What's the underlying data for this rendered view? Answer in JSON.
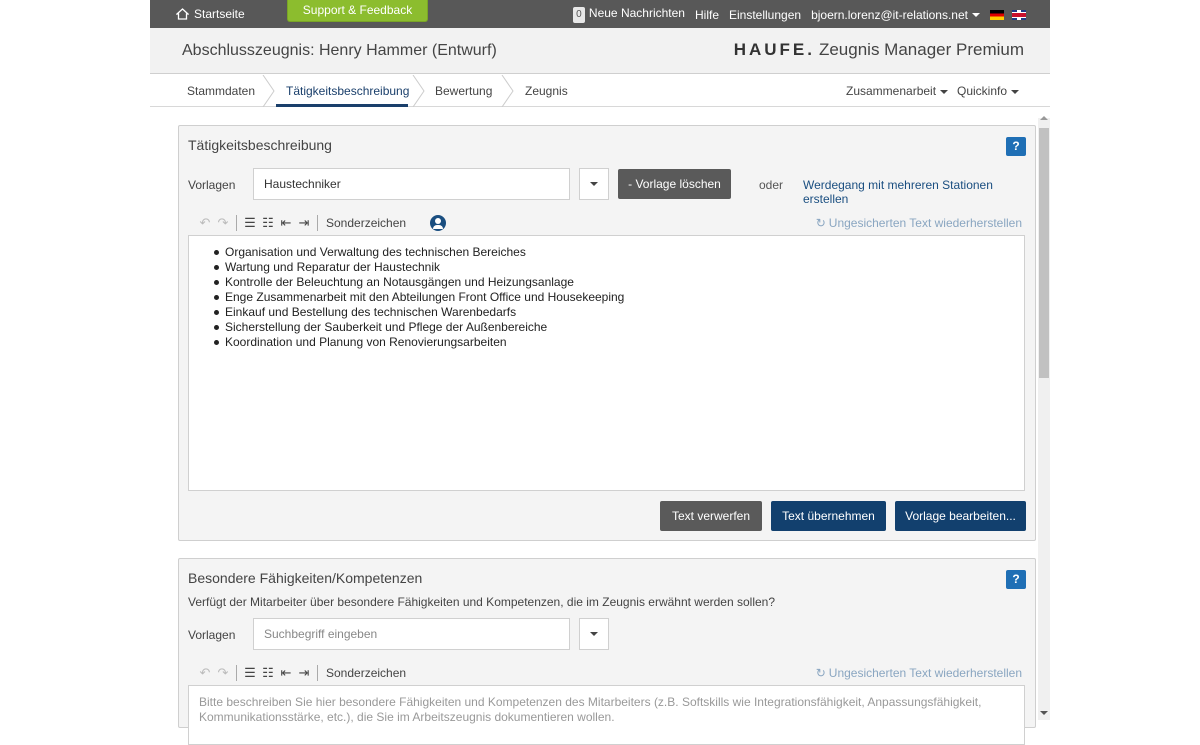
{
  "topbar": {
    "home_label": "Startseite",
    "support_label": "Support & Feedback",
    "messages_count": "0",
    "messages_label": "Neue Nachrichten",
    "help_label": "Hilfe",
    "settings_label": "Einstellungen",
    "user_email": "bjoern.lorenz@it-relations.net"
  },
  "header": {
    "doc_title": "Abschlusszeugnis: Henry Hammer (Entwurf)",
    "brand_logo": "HAUFE.",
    "brand_product": "Zeugnis Manager Premium"
  },
  "tabs": {
    "items": [
      "Stammdaten",
      "Tätigkeitsbeschreibung",
      "Bewertung",
      "Zeugnis"
    ],
    "active": "Tätigkeitsbeschreibung",
    "menu_collab": "Zusammenarbeit",
    "menu_quickinfo": "Quickinfo"
  },
  "panel1": {
    "title": "Tätigkeitsbeschreibung",
    "help": "?",
    "vorlagen_label": "Vorlagen",
    "vorlagen_value": "Haustechniker",
    "delete_template": "- Vorlage löschen",
    "or_label": "oder",
    "career_link": "Werdegang mit mehreren Stationen erstellen",
    "toolbar_special": "Sonderzeichen",
    "restore_label": "Ungesicherten Text wiederherstellen",
    "bullets": [
      "Organisation und Verwaltung des technischen Bereiches",
      "Wartung und Reparatur der Haustechnik",
      "Kontrolle der Beleuchtung an Notausgängen und Heizungsanlage",
      "Enge Zusammenarbeit mit den Abteilungen Front Office und Housekeeping",
      "Einkauf und Bestellung des technischen Warenbedarfs",
      "Sicherstellung der Sauberkeit und Pflege der Außenbereiche",
      "Koordination und Planung von Renovierungsarbeiten"
    ],
    "btn_discard": "Text verwerfen",
    "btn_accept": "Text übernehmen",
    "btn_edit_template": "Vorlage bearbeiten..."
  },
  "panel2": {
    "title": "Besondere Fähigkeiten/Kompetenzen",
    "help": "?",
    "question": "Verfügt der Mitarbeiter über besondere Fähigkeiten und Kompetenzen, die im Zeugnis erwähnt werden sollen?",
    "vorlagen_label": "Vorlagen",
    "search_placeholder": "Suchbegriff eingeben",
    "toolbar_special": "Sonderzeichen",
    "restore_label": "Ungesicherten Text wiederherstellen",
    "editor_placeholder": "Bitte beschreiben Sie hier besondere Fähigkeiten und Kompetenzen des Mitarbeiters (z.B. Softskills wie Integrationsfähigkeit, Anpassungsfähigkeit, Kommunikationsstärke, etc.), die Sie im Arbeitszeugnis dokumentieren wollen."
  },
  "colors": {
    "topbar": "#585858",
    "support": "#8cbd2e",
    "primary_blue": "#12406e",
    "button_gray": "#5a5a5a",
    "help_blue": "#1f6fb5"
  }
}
